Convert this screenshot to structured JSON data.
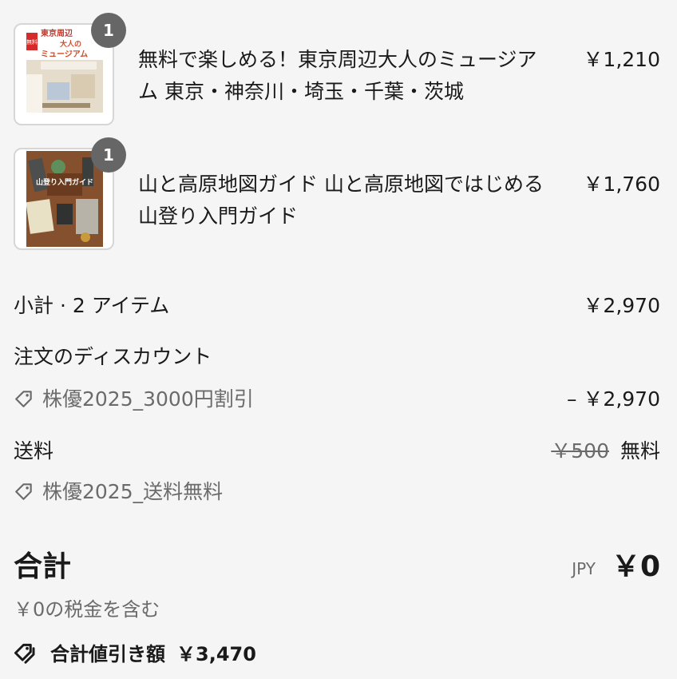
{
  "line_items": [
    {
      "quantity": "1",
      "title": "無料で楽しめる！東京周辺大人のミュージアム 東京・神奈川・埼玉・千葉・茨城",
      "price": "￥1,210",
      "cover_text": {
        "line1": "東京周辺",
        "line2": "大人の",
        "line3": "ミュージアム",
        "badge": "無料"
      }
    },
    {
      "quantity": "1",
      "title": "山と高原地図ガイド 山と高原地図ではじめる山登り入門ガイド",
      "price": "￥1,760",
      "cover_text": {
        "line1": "山登り入門ガイド"
      }
    }
  ],
  "summary": {
    "subtotal_label": "小計 · 2 アイテム",
    "subtotal_value": "￥2,970",
    "order_discount_label": "注文のディスカウント",
    "order_discount_code": "株優2025_3000円割引",
    "order_discount_value": "– ￥2,970",
    "shipping_label": "送料",
    "shipping_original": "￥500",
    "shipping_value": "無料",
    "shipping_discount_code": "株優2025_送料無料",
    "total_label": "合計",
    "currency_code": "JPY",
    "total_value": "￥0",
    "tax_note": "￥0の税金を含む",
    "total_savings_label": "合計値引き額",
    "total_savings_value": "￥3,470"
  },
  "colors": {
    "background": "#f5f5f5",
    "text": "#1a1a1a",
    "muted": "#6b6b6b",
    "badge": "#666666"
  }
}
